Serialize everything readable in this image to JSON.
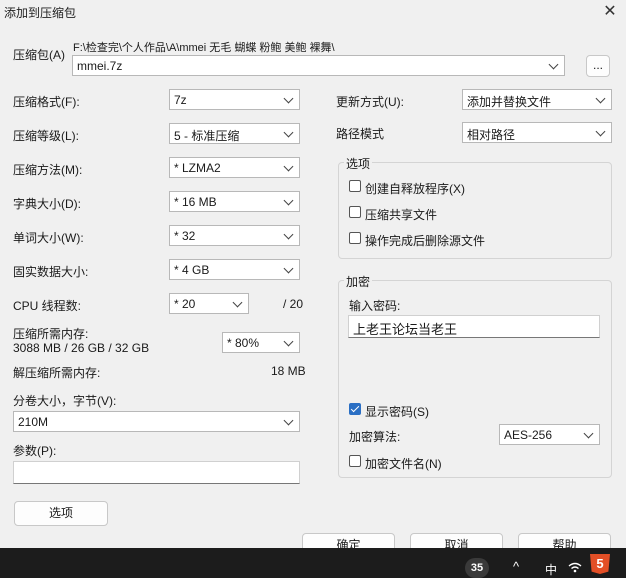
{
  "window": {
    "title": "添加到压缩包"
  },
  "archive": {
    "label": "压缩包(A)",
    "path": "F:\\检查完\\个人作品\\A\\mmei 无毛 蝴蝶 粉鲍 美鲍 裸舞\\",
    "filename": "mmei.7z",
    "browse_label": "..."
  },
  "left": {
    "format_label": "压缩格式(F):",
    "format_value": "7z",
    "level_label": "压缩等级(L):",
    "level_value": "5 - 标准压缩",
    "method_label": "压缩方法(M):",
    "method_value": "*  LZMA2",
    "dict_label": "字典大小(D):",
    "dict_value": "*  16 MB",
    "word_label": "单词大小(W):",
    "word_value": "*  32",
    "solid_label": "固实数据大小:",
    "solid_value": "*  4 GB",
    "cpu_label": "CPU 线程数:",
    "cpu_value": "*  20",
    "cpu_total": "/ 20",
    "mem_label": "压缩所需内存:",
    "mem_detail": "3088 MB / 26 GB / 32 GB",
    "mem_value": "* 80%",
    "decomp_label": "解压缩所需内存:",
    "decomp_value": "18 MB",
    "split_label": "分卷大小，字节(V):",
    "split_value": "210M",
    "params_label": "参数(P):",
    "params_value": "",
    "options_button": "选项"
  },
  "right": {
    "update_label": "更新方式(U):",
    "update_value": "添加并替换文件",
    "path_label": "路径模式",
    "path_value": "相对路径",
    "options_group": "选项",
    "sfx_label": "创建自释放程序(X)",
    "sfx_checked": false,
    "shared_label": "压缩共享文件",
    "shared_checked": false,
    "delete_label": "操作完成后删除源文件",
    "delete_checked": false,
    "encrypt_group": "加密",
    "password_label": "输入密码:",
    "password_value": "上老王论坛当老王",
    "show_pw_label": "显示密码(S)",
    "show_pw_checked": true,
    "method_label": "加密算法:",
    "method_value": "AES-256",
    "encrypt_names_label": "加密文件名(N)",
    "encrypt_names_checked": false
  },
  "buttons": {
    "ok": "确定",
    "cancel": "取消",
    "help": "帮助"
  },
  "taskbar": {
    "badge": "35",
    "ime": "中",
    "chevron": "^",
    "wifi": "wifi-icon",
    "html5": "5"
  }
}
